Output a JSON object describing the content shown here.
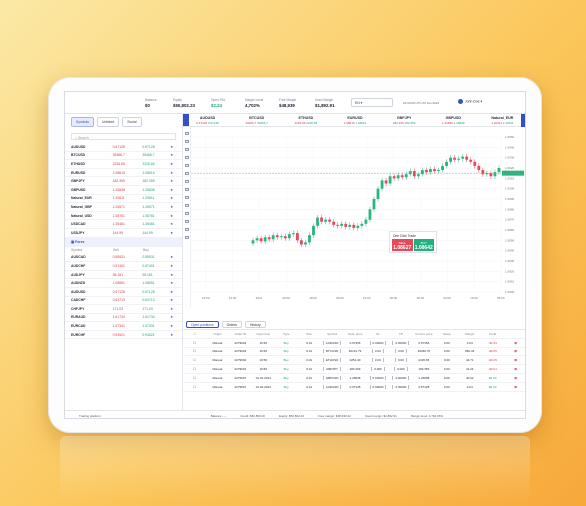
{
  "header": {
    "stats": [
      {
        "key": "Balance",
        "value": "$0"
      },
      {
        "key": "Equity",
        "value": "$50,802.23"
      },
      {
        "key": "Open P&L",
        "value": "$2.24",
        "green": true
      },
      {
        "key": "Margin Level",
        "value": "4,702%"
      },
      {
        "key": "Free Margin",
        "value": "$48,939"
      },
      {
        "key": "Used Margin",
        "value": "$1,892.91"
      }
    ],
    "language": "EN",
    "clock": "24:00:00 UTC 00 Jan 2024",
    "user": "John Doe"
  },
  "left": {
    "tabs": [
      "Symbols",
      "Unlisted",
      "Social"
    ],
    "search_placeholder": "Search",
    "watchlist": [
      {
        "name": "AUDUSD",
        "bid": "0.67128",
        "ask": "0.67128"
      },
      {
        "name": "BTCUSD",
        "bid": "39466.7",
        "ask": "39466.7"
      },
      {
        "name": "ETHUSD",
        "bid": "2226.65",
        "ask": "2226.65"
      },
      {
        "name": "EURUSD",
        "bid": "1.08615",
        "ask": "1.08615"
      },
      {
        "name": "GBPJPY",
        "bid": "182.359",
        "ask": "182.359"
      },
      {
        "name": "GBPUSD",
        "bid": "1.26838",
        "ask": "1.26838"
      },
      {
        "name": "Natural_EUR",
        "bid": "1.20611",
        "ask": "1.20611"
      },
      {
        "name": "Natural_GBP",
        "bid": "1.26571",
        "ask": "1.26571"
      },
      {
        "name": "Natural_USD",
        "bid": "1.08761",
        "ask": "1.08761"
      },
      {
        "name": "USDCAD",
        "bid": "1.35461",
        "ask": "1.35461"
      },
      {
        "name": "USDJPY",
        "bid": "144.99",
        "ask": "144.99"
      }
    ],
    "forex_label": "Forex",
    "col_symbol": "Symbol",
    "col_bid": "Sell",
    "col_ask": "Buy",
    "forex": [
      {
        "name": "AUDCAD",
        "bid": "0.89531",
        "ask": "0.89531"
      },
      {
        "name": "AUDCHF",
        "bid": "0.57401",
        "ask": "0.57401"
      },
      {
        "name": "AUDJPY",
        "bid": "98.181",
        "ask": "98.181"
      },
      {
        "name": "AUDNZD",
        "bid": "1.08651",
        "ask": "1.08651"
      },
      {
        "name": "AUDUSD",
        "bid": "0.67128",
        "ask": "0.67128"
      },
      {
        "name": "CADCHF",
        "bid": "0.63713",
        "ask": "0.63713"
      },
      {
        "name": "CHFJPY",
        "bid": "171.03",
        "ask": "171.03"
      },
      {
        "name": "EURAUD",
        "bid": "1.61734",
        "ask": "1.61734"
      },
      {
        "name": "EURCAD",
        "bid": "1.47331",
        "ask": "1.47331"
      },
      {
        "name": "EURCHF",
        "bid": "0.94521",
        "ask": "0.94521"
      }
    ]
  },
  "ticker": [
    {
      "name": "AUDUSD",
      "sell": "0.67128",
      "buy": "0.67128"
    },
    {
      "name": "BTCUSD",
      "sell": "39466.7",
      "buy": "39466.7"
    },
    {
      "name": "ETHUSD",
      "sell": "2226.65",
      "buy": "2226.65"
    },
    {
      "name": "EURUSD",
      "sell": "1.08615",
      "buy": "1.08615"
    },
    {
      "name": "GBPJPY",
      "sell": "182.359",
      "buy": "182.359"
    },
    {
      "name": "GBPUSD",
      "sell": "1.26838",
      "buy": "1.26838"
    },
    {
      "name": "Natural_EUR",
      "sell": "1.20611",
      "buy": "1.20611"
    }
  ],
  "chart": {
    "symbol": "EURUSD",
    "oneclick_title": "One Click Trade",
    "sell_label": "SELL",
    "buy_label": "BUY",
    "sell_price": "1.08627",
    "buy_price": "1.08642"
  },
  "positions": {
    "tabs": [
      "Open positions",
      "Orders",
      "History"
    ],
    "columns": [
      "Origin",
      "Order ID",
      "Open time",
      "Type",
      "Size",
      "Symbol",
      "Open price",
      "SL",
      "TP",
      "Current price",
      "Swap",
      "Margin",
      "Profit"
    ],
    "rows": [
      {
        "origin": "Manual",
        "id": "2279604",
        "time": "16:56",
        "type": "Buy",
        "size": "0.01",
        "symbol": "AUDUSD",
        "open": "0.67356",
        "sl": "0.00000",
        "tp": "0.00000",
        "cur": "0.67356",
        "swap": "0.00",
        "margin": "3.04",
        "profit": "-$2.33"
      },
      {
        "origin": "Manual",
        "id": "2279603",
        "time": "16:56",
        "type": "Buy",
        "size": "0.01",
        "symbol": "BTCUSD",
        "open": "40131.79",
        "sl": "0.00",
        "tp": "0.00",
        "cur": "39466.70",
        "swap": "0.00",
        "margin": "860.34",
        "profit": "-$6.65"
      },
      {
        "origin": "Manual",
        "id": "2279602",
        "time": "16:56",
        "type": "Buy",
        "size": "0.01",
        "symbol": "ETHUSD",
        "open": "2251.40",
        "sl": "0.00",
        "tp": "0.00",
        "cur": "2226.65",
        "swap": "0.00",
        "margin": "44.71",
        "profit": "-$0.25"
      },
      {
        "origin": "Manual",
        "id": "2279601",
        "time": "16:56",
        "type": "Buy",
        "size": "0.01",
        "symbol": "GBPJPY",
        "open": "182.369",
        "sl": "0.000",
        "tp": "0.000",
        "cur": "182.359",
        "swap": "0.00",
        "margin": "41.24",
        "profit": "-$0.01"
      },
      {
        "origin": "Manual",
        "id": "2279597",
        "time": "01.02.2024",
        "type": "Buy",
        "size": "0.01",
        "symbol": "GBPUSD",
        "open": "1.26838",
        "sl": "0.00000",
        "tp": "0.00000",
        "cur": "1.26838",
        "swap": "0.00",
        "margin": "40.62",
        "profit": "$0.00"
      },
      {
        "origin": "Manual",
        "id": "2279597",
        "time": "01.02.2024",
        "type": "Buy",
        "size": "0.01",
        "symbol": "AUDUSD",
        "open": "0.67128",
        "sl": "0.00000",
        "tp": "0.00000",
        "cur": "0.67128",
        "swap": "0.00",
        "margin": "3.04",
        "profit": "$0.00"
      }
    ]
  },
  "footer": {
    "platform": "Trading platform",
    "balance": "Balance: —",
    "credit": "Credit: $50,800.00",
    "equity": "Equity: $50,802.23",
    "free_margin": "Free margin: $48,939.32",
    "used_margin": "Used margin: $1,892.91",
    "margin_level": "Margin level: 4,702.06%"
  },
  "chart_data": {
    "type": "candlestick",
    "symbol": "EURUSD",
    "ylim": [
      1.08,
      1.095
    ],
    "yticks": [
      "1.0950",
      "1.0940",
      "1.0930",
      "1.0920",
      "1.0910",
      "1.0900",
      "1.0890",
      "1.0880",
      "1.0870",
      "1.0860",
      "1.0850",
      "1.0840",
      "1.0830",
      "1.0820",
      "1.0810",
      "1.0800"
    ],
    "xticks": [
      "16:00",
      "12:00",
      "2024",
      "06:00",
      "18:00",
      "06:00",
      "16:00",
      "06:00",
      "18:00",
      "06:00",
      "16:00",
      "06:00"
    ],
    "closes": [
      1.085,
      1.0852,
      1.0849,
      1.0853,
      1.0851,
      1.0855,
      1.0853,
      1.0854,
      1.0852,
      1.0856,
      1.0857,
      1.085,
      1.0846,
      1.0848,
      1.0855,
      1.0864,
      1.0872,
      1.0868,
      1.087,
      1.0868,
      1.0865,
      1.0864,
      1.0866,
      1.0863,
      1.0865,
      1.0862,
      1.0864,
      1.0866,
      1.087,
      1.088,
      1.089,
      1.09,
      1.0908,
      1.0905,
      1.0912,
      1.091,
      1.0913,
      1.0911,
      1.0914,
      1.0917,
      1.0912,
      1.0914,
      1.0918,
      1.0916,
      1.0919,
      1.0917,
      1.0918,
      1.0922,
      1.0926,
      1.093,
      1.0928,
      1.0929,
      1.0931,
      1.0928,
      1.0926,
      1.0922,
      1.0918,
      1.0914,
      1.0915,
      1.0912,
      1.0916,
      1.092
    ],
    "last_price_line": 1.0915
  }
}
